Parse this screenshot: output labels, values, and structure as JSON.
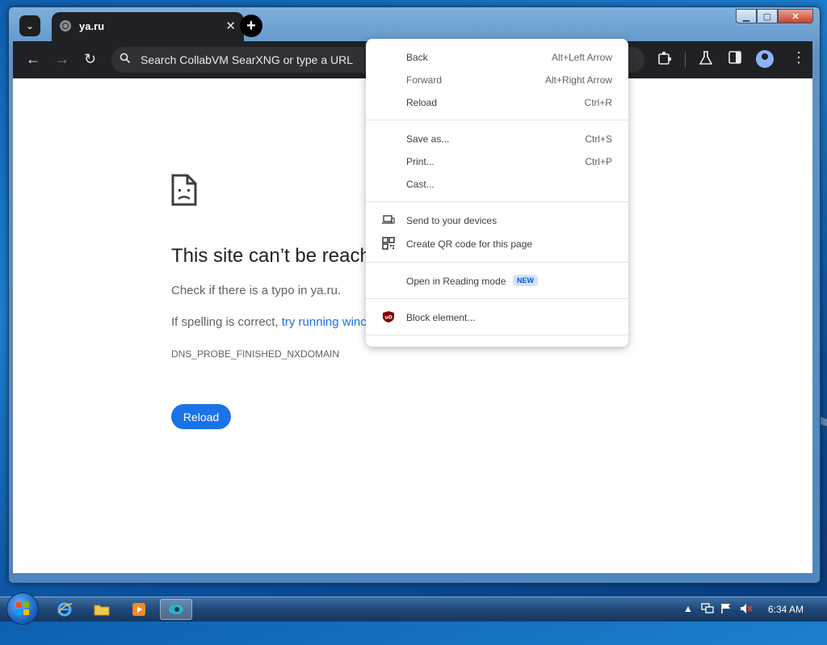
{
  "window": {
    "controls": {
      "minimize": "▁",
      "maximize": "▢",
      "close": "✕"
    }
  },
  "browser": {
    "tab": {
      "title": "ya.ru",
      "close": "✕"
    },
    "new_tab": "+",
    "tab_search": "⌄",
    "nav": {
      "back": "←",
      "forward": "→",
      "reload": "↻"
    },
    "omnibox": {
      "placeholder": "Search CollabVM SearXNG or type a URL",
      "search_icon": "search-icon"
    },
    "toolbar_icons": [
      "extensions-icon",
      "labs-icon",
      "side-panel-icon",
      "profile-icon",
      "menu-icon"
    ]
  },
  "error_page": {
    "title": "This site can’t be reach",
    "line1": "Check if there is a typo in ya.ru.",
    "line2_prefix": "If spelling is correct, ",
    "line2_link": "try running winc",
    "code": "DNS_PROBE_FINISHED_NXDOMAIN",
    "reload_label": "Reload"
  },
  "context_menu": {
    "back": {
      "label": "Back",
      "shortcut": "Alt+Left Arrow"
    },
    "forward": {
      "label": "Forward",
      "shortcut": "Alt+Right Arrow"
    },
    "reload": {
      "label": "Reload",
      "shortcut": "Ctrl+R"
    },
    "save_as": {
      "label": "Save as...",
      "shortcut": "Ctrl+S"
    },
    "print": {
      "label": "Print...",
      "shortcut": "Ctrl+P"
    },
    "cast": {
      "label": "Cast..."
    },
    "send": {
      "label": "Send to your devices"
    },
    "qr": {
      "label": "Create QR code for this page"
    },
    "reading": {
      "label": "Open in Reading mode",
      "badge": "NEW"
    },
    "block": {
      "label": "Block element...",
      "icon_text": "uO"
    }
  },
  "taskbar": {
    "clock": "6:34 AM",
    "tray_arrow": "▲"
  },
  "colors": {
    "accent": "#1a73e8",
    "browser_dark": "#202124",
    "desktop": "#1c7fd0"
  }
}
